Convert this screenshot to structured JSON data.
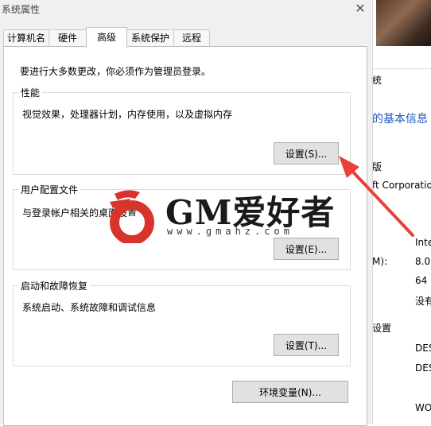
{
  "dialog": {
    "title": "系统属性",
    "close_glyph": "✕",
    "tabs": [
      {
        "label": "计算机名"
      },
      {
        "label": "硬件"
      },
      {
        "label": "高级"
      },
      {
        "label": "系统保护"
      },
      {
        "label": "远程"
      }
    ],
    "active_tab": "高级",
    "admin_note": "要进行大多数更改，你必须作为管理员登录。",
    "performance": {
      "legend": "性能",
      "desc": "视觉效果，处理器计划，内存使用，以及虚拟内存",
      "button": "设置(S)..."
    },
    "profiles": {
      "legend": "用户配置文件",
      "desc": "与登录帐户相关的桌面设置",
      "button": "设置(E)..."
    },
    "startup": {
      "legend": "启动和故障恢复",
      "desc": "系统启动、系统故障和调试信息",
      "button": "设置(T)..."
    },
    "env_button": "环境变量(N)..."
  },
  "background_window": {
    "items": [
      "统",
      "的基本信息",
      "版",
      "ft Corporatio",
      "Inte",
      "M):",
      "8.0",
      "64",
      "没有",
      "设置",
      "DES",
      "DES",
      "WO"
    ]
  },
  "watermark": {
    "title": "GM爱好者",
    "url": "www.gmahz.com"
  },
  "colors": {
    "dialog_bg": "#f0f0f0",
    "panel_bg": "#ffffff",
    "button_bg": "#e1e1e1",
    "link_blue": "#1a55c4",
    "arrow_red": "#e8403a",
    "logo_red": "#d9342b"
  }
}
